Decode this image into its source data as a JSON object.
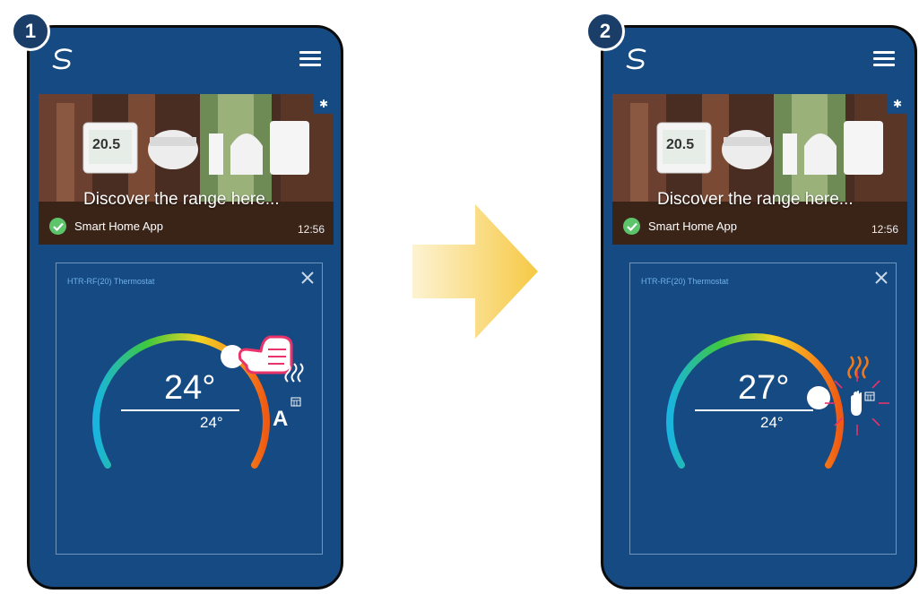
{
  "steps": [
    {
      "number": "1",
      "banner": {
        "headline": "Discover the range here...",
        "app_name": "Smart Home App",
        "time": "12:56",
        "thermostat_display": "20.5"
      },
      "card": {
        "title": "HTR-RF(20) Thermostat",
        "set_temperature": "24°",
        "current_temperature": "24°",
        "mode_label": "A"
      }
    },
    {
      "number": "2",
      "banner": {
        "headline": "Discover the range here...",
        "app_name": "Smart Home App",
        "time": "12:56",
        "thermostat_display": "20.5"
      },
      "card": {
        "title": "HTR-RF(20) Thermostat",
        "set_temperature": "27°",
        "current_temperature": "24°"
      }
    }
  ],
  "colors": {
    "phone_bg": "#164a82",
    "accent_heat": "#f07a1a",
    "highlight": "#e8336b",
    "arrow": "#f6c944"
  }
}
